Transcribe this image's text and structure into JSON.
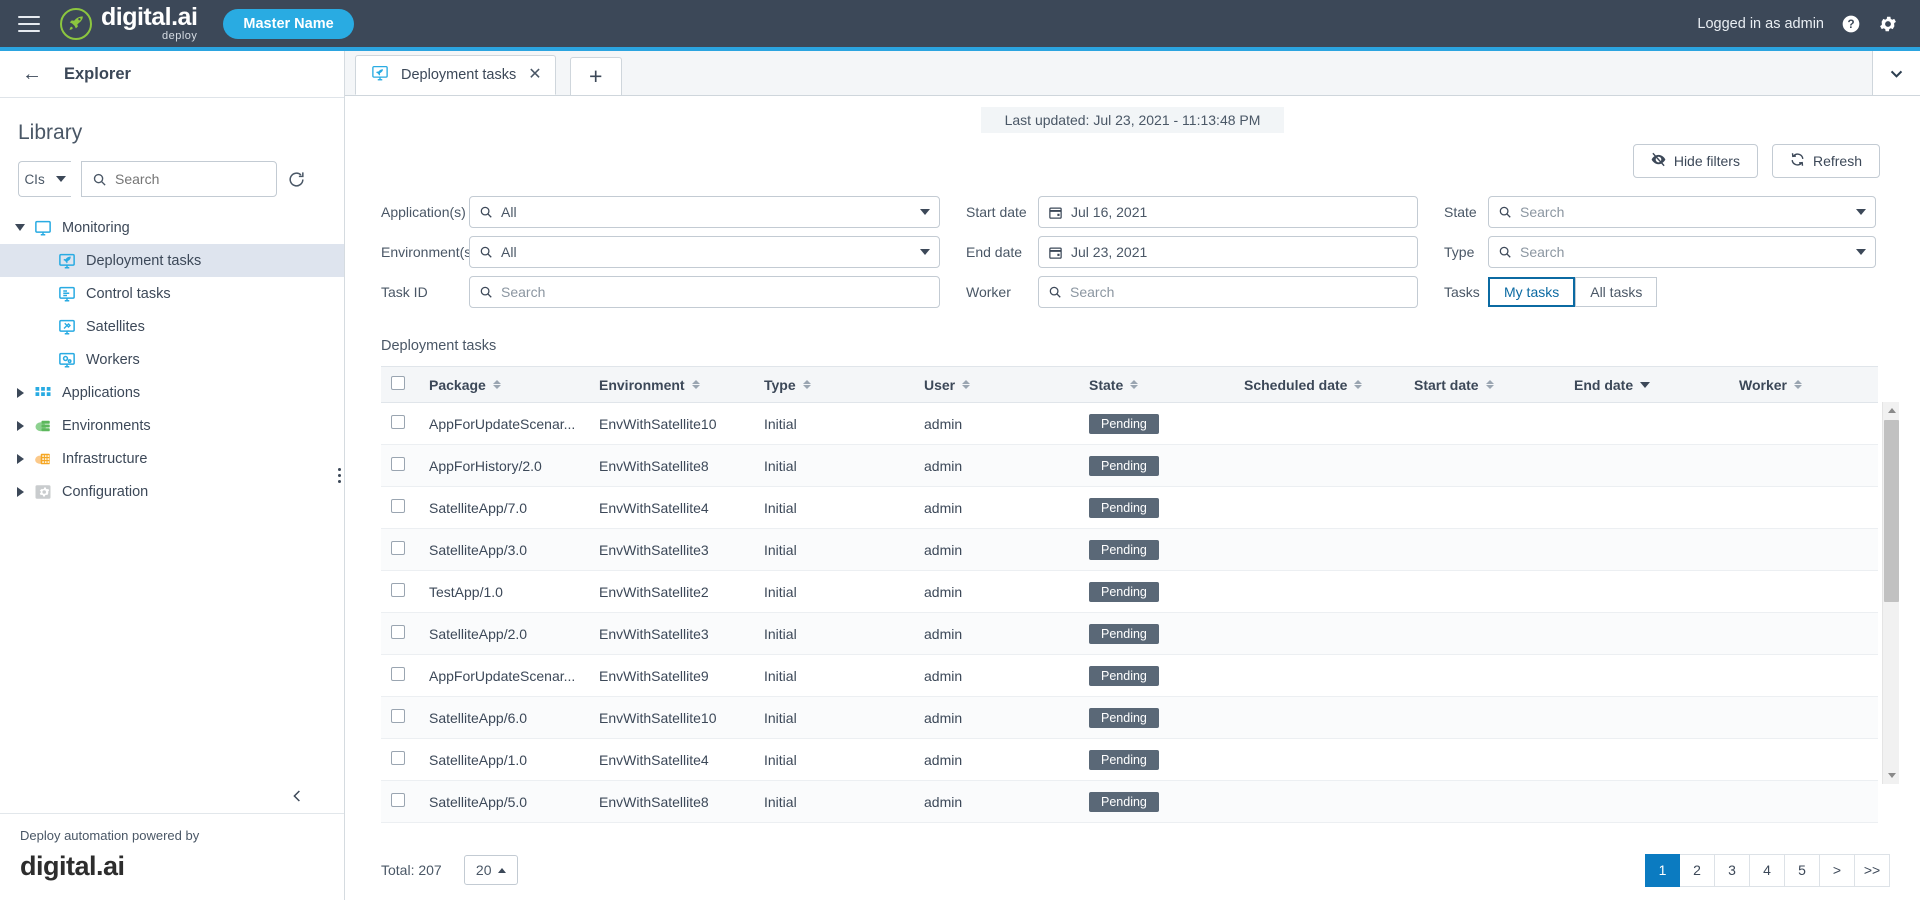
{
  "topbar": {
    "brand_main": "digital.ai",
    "brand_sub": "deploy",
    "master_pill": "Master Name",
    "logged_in": "Logged in as admin",
    "menu_icon": "hamburger-icon",
    "help_icon": "help-circle-icon",
    "settings_icon": "gear-icon"
  },
  "sidebar": {
    "back_arrow": "←",
    "explorer_title": "Explorer",
    "library_title": "Library",
    "cls_label": "CIs",
    "search_placeholder": "Search",
    "search_value": "",
    "tree": [
      {
        "label": "Monitoring",
        "depth": 0,
        "expanded": true,
        "has_children": true,
        "selected": false,
        "icon": "monitor-icon"
      },
      {
        "label": "Deployment tasks",
        "depth": 1,
        "expanded": false,
        "has_children": false,
        "selected": true,
        "icon": "rocket-monitor-icon"
      },
      {
        "label": "Control tasks",
        "depth": 1,
        "expanded": false,
        "has_children": false,
        "selected": false,
        "icon": "list-monitor-icon"
      },
      {
        "label": "Satellites",
        "depth": 1,
        "expanded": false,
        "has_children": false,
        "selected": false,
        "icon": "satellite-monitor-icon"
      },
      {
        "label": "Workers",
        "depth": 1,
        "expanded": false,
        "has_children": false,
        "selected": false,
        "icon": "gears-monitor-icon"
      },
      {
        "label": "Applications",
        "depth": 0,
        "expanded": false,
        "has_children": true,
        "selected": false,
        "icon": "grid-blue-icon"
      },
      {
        "label": "Environments",
        "depth": 0,
        "expanded": false,
        "has_children": true,
        "selected": false,
        "icon": "server-green-icon"
      },
      {
        "label": "Infrastructure",
        "depth": 0,
        "expanded": false,
        "has_children": true,
        "selected": false,
        "icon": "building-orange-icon"
      },
      {
        "label": "Configuration",
        "depth": 0,
        "expanded": false,
        "has_children": true,
        "selected": false,
        "icon": "cog-grey-icon"
      }
    ],
    "collapse_icon": "chevron-left-icon",
    "powered_text": "Deploy automation powered by",
    "footer_logo": "digital.ai"
  },
  "tabs": {
    "items": [
      {
        "label": "Deployment tasks",
        "icon": "rocket-monitor-icon",
        "active": true
      }
    ],
    "add_label": "+",
    "close_label": "✕",
    "overflow_icon": "chevron-down-icon"
  },
  "toolbar": {
    "last_updated": "Last updated: Jul 23, 2021 - 11:13:48 PM",
    "hide_filters_label": "Hide filters",
    "refresh_label": "Refresh",
    "hide_filters_icon": "filter-eye-icon",
    "refresh_icon": "refresh-icon"
  },
  "filters": {
    "application_label": "Application(s)",
    "application_value": "All",
    "environment_label": "Environment(s)",
    "environment_value": "All",
    "taskid_label": "Task ID",
    "taskid_placeholder": "Search",
    "taskid_value": "",
    "start_date_label": "Start date",
    "start_date_value": "Jul 16, 2021",
    "end_date_label": "End date",
    "end_date_value": "Jul 23, 2021",
    "worker_label": "Worker",
    "worker_placeholder": "Search",
    "worker_value": "",
    "state_label": "State",
    "state_placeholder": "Search",
    "state_value": "",
    "type_label": "Type",
    "type_placeholder": "Search",
    "type_value": "",
    "tasks_label": "Tasks",
    "tasks_options": [
      "My tasks",
      "All tasks"
    ],
    "tasks_selected": "My tasks"
  },
  "table": {
    "title": "Deployment tasks",
    "columns": [
      {
        "label": "Package",
        "sort": "none"
      },
      {
        "label": "Environment",
        "sort": "none"
      },
      {
        "label": "Type",
        "sort": "none"
      },
      {
        "label": "User",
        "sort": "none"
      },
      {
        "label": "State",
        "sort": "none"
      },
      {
        "label": "Scheduled date",
        "sort": "none"
      },
      {
        "label": "Start date",
        "sort": "none"
      },
      {
        "label": "End date",
        "sort": "desc"
      },
      {
        "label": "Worker",
        "sort": "none"
      }
    ],
    "rows": [
      {
        "package": "AppForUpdateScenar...",
        "environment": "EnvWithSatellite10",
        "type": "Initial",
        "user": "admin",
        "state": "Pending",
        "scheduled_date": "",
        "start_date": "",
        "end_date": "",
        "worker": ""
      },
      {
        "package": "AppForHistory/2.0",
        "environment": "EnvWithSatellite8",
        "type": "Initial",
        "user": "admin",
        "state": "Pending",
        "scheduled_date": "",
        "start_date": "",
        "end_date": "",
        "worker": ""
      },
      {
        "package": "SatelliteApp/7.0",
        "environment": "EnvWithSatellite4",
        "type": "Initial",
        "user": "admin",
        "state": "Pending",
        "scheduled_date": "",
        "start_date": "",
        "end_date": "",
        "worker": ""
      },
      {
        "package": "SatelliteApp/3.0",
        "environment": "EnvWithSatellite3",
        "type": "Initial",
        "user": "admin",
        "state": "Pending",
        "scheduled_date": "",
        "start_date": "",
        "end_date": "",
        "worker": ""
      },
      {
        "package": "TestApp/1.0",
        "environment": "EnvWithSatellite2",
        "type": "Initial",
        "user": "admin",
        "state": "Pending",
        "scheduled_date": "",
        "start_date": "",
        "end_date": "",
        "worker": ""
      },
      {
        "package": "SatelliteApp/2.0",
        "environment": "EnvWithSatellite3",
        "type": "Initial",
        "user": "admin",
        "state": "Pending",
        "scheduled_date": "",
        "start_date": "",
        "end_date": "",
        "worker": ""
      },
      {
        "package": "AppForUpdateScenar...",
        "environment": "EnvWithSatellite9",
        "type": "Initial",
        "user": "admin",
        "state": "Pending",
        "scheduled_date": "",
        "start_date": "",
        "end_date": "",
        "worker": ""
      },
      {
        "package": "SatelliteApp/6.0",
        "environment": "EnvWithSatellite10",
        "type": "Initial",
        "user": "admin",
        "state": "Pending",
        "scheduled_date": "",
        "start_date": "",
        "end_date": "",
        "worker": ""
      },
      {
        "package": "SatelliteApp/1.0",
        "environment": "EnvWithSatellite4",
        "type": "Initial",
        "user": "admin",
        "state": "Pending",
        "scheduled_date": "",
        "start_date": "",
        "end_date": "",
        "worker": ""
      },
      {
        "package": "SatelliteApp/5.0",
        "environment": "EnvWithSatellite8",
        "type": "Initial",
        "user": "admin",
        "state": "Pending",
        "scheduled_date": "",
        "start_date": "",
        "end_date": "",
        "worker": ""
      }
    ]
  },
  "footer": {
    "total": "Total: 207",
    "page_size": "20",
    "pages": [
      "1",
      "2",
      "3",
      "4",
      "5",
      ">",
      ">>"
    ],
    "current_page": "1"
  },
  "colors": {
    "header_bg": "#3c4858",
    "accent_blue": "#2ba4e0",
    "pill_blue": "#29abe2",
    "brand_green": "#8cc63f",
    "badge_grey": "#5a6877",
    "pager_active": "#0b7bc1",
    "selected_row": "#dee4ee"
  }
}
